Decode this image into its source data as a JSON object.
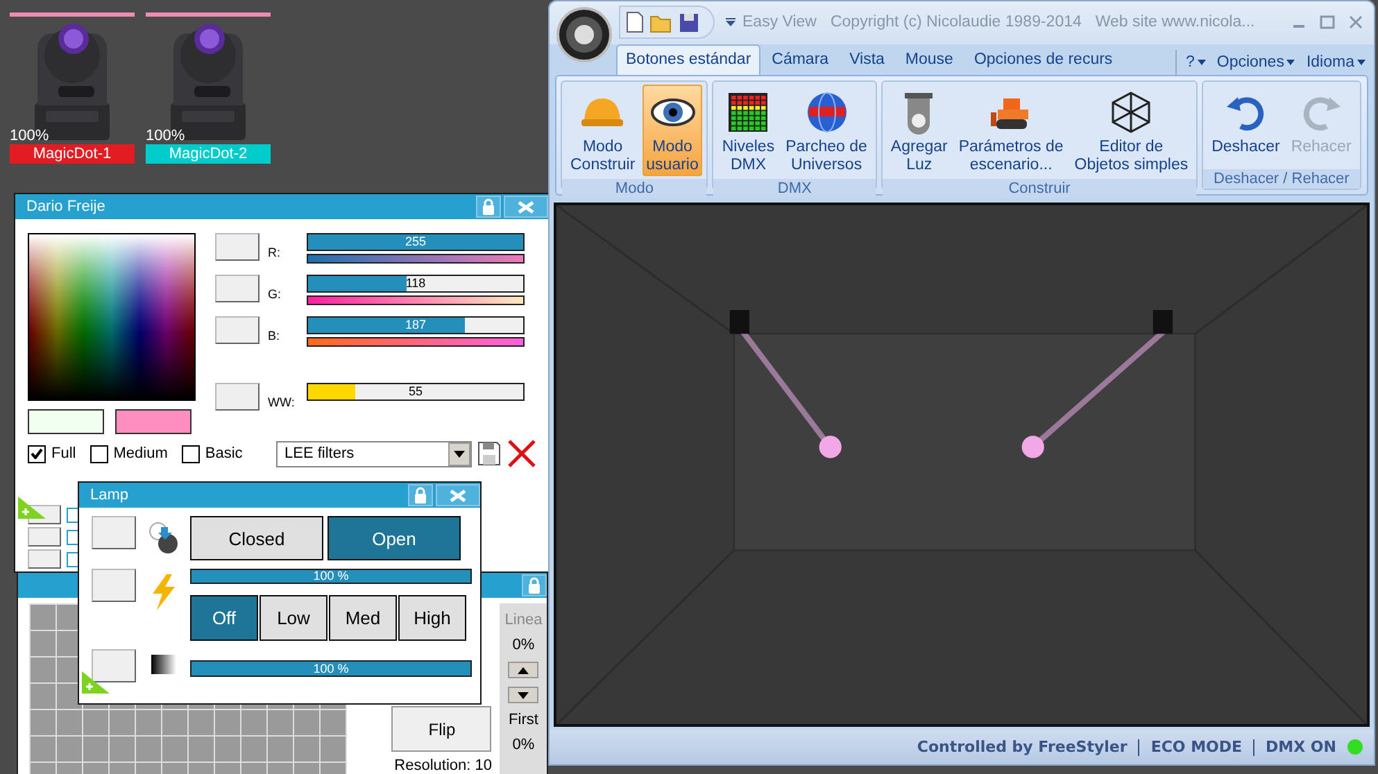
{
  "fixtures": [
    {
      "name": "MagicDot-1",
      "intensity": "100%",
      "color": "#e31b23"
    },
    {
      "name": "MagicDot-2",
      "intensity": "100%",
      "color": "#00cccc"
    }
  ],
  "color_window": {
    "title": "Dario Freije",
    "channels": [
      {
        "kind": "rgb",
        "name": "R:",
        "value": "255",
        "level": 1
      },
      {
        "kind": "rgb",
        "name": "G:",
        "value": "118",
        "level": 0.46
      },
      {
        "kind": "rgb",
        "name": "B:",
        "value": "187",
        "level": 0.73
      },
      {
        "kind": "white",
        "name": "WW:",
        "value": "55",
        "level": 0.22
      }
    ],
    "modes": [
      {
        "label": "Full",
        "checked": true
      },
      {
        "label": "Medium",
        "checked": false
      },
      {
        "label": "Basic",
        "checked": false
      }
    ],
    "filter_select": {
      "value": "LEE filters"
    }
  },
  "lamp_window": {
    "title": "Lamp",
    "shutter": [
      {
        "label": "Closed",
        "selected": false
      },
      {
        "label": "Open",
        "selected": true
      }
    ],
    "lamp_bar": {
      "reading": "100 %",
      "level": 1
    },
    "power": [
      {
        "label": "Off",
        "selected": true
      },
      {
        "label": "Low",
        "selected": false
      },
      {
        "label": "Med",
        "selected": false
      },
      {
        "label": "High",
        "selected": false
      }
    ],
    "dimmer_bar": {
      "reading": "100 %",
      "level": 1
    }
  },
  "back_window": {
    "button": "Flip",
    "resolution": "Resolution: 10",
    "side_title": "Linea",
    "top_reading": "0%",
    "first_label": "First",
    "bottom_reading": "0%"
  },
  "main_window": {
    "app_name": "Easy View",
    "copyright": "Copyright (c) Nicolaudie 1989-2014",
    "website": "Web site www.nicola...",
    "tabs": [
      {
        "label": "Botones estándar",
        "selected": true
      },
      {
        "label": "Cámara",
        "selected": false
      },
      {
        "label": "Vista",
        "selected": false
      },
      {
        "label": "Mouse",
        "selected": false
      },
      {
        "label": "Opciones de recurs",
        "selected": false
      }
    ],
    "menus": [
      "?",
      "Opciones",
      "Idioma"
    ],
    "groups": [
      {
        "label": "Modo",
        "buttons": [
          {
            "kind": "helmet",
            "lines": [
              "Modo",
              "Construir"
            ],
            "selected": false,
            "disabled": false
          },
          {
            "kind": "eye",
            "lines": [
              "Modo",
              "usuario"
            ],
            "selected": true,
            "disabled": false
          }
        ]
      },
      {
        "label": "DMX",
        "buttons": [
          {
            "kind": "levels",
            "lines": [
              "Niveles",
              "DMX"
            ],
            "selected": false,
            "disabled": false
          },
          {
            "kind": "globe",
            "lines": [
              "Parcheo de",
              "Universos"
            ],
            "selected": false,
            "disabled": false
          }
        ]
      },
      {
        "label": "Construir",
        "buttons": [
          {
            "kind": "spotlight",
            "lines": [
              "Agregar",
              "Luz"
            ],
            "selected": false,
            "disabled": false
          },
          {
            "kind": "bulldozer",
            "lines": [
              "Parámetros de",
              "escenario..."
            ],
            "selected": false,
            "disabled": false
          },
          {
            "kind": "cube",
            "lines": [
              "Editor de",
              "Objetos simples"
            ],
            "selected": false,
            "disabled": false
          }
        ]
      },
      {
        "label": "Deshacer / Rehacer",
        "buttons": [
          {
            "kind": "undo",
            "lines": [
              "Deshacer"
            ],
            "selected": false,
            "disabled": false
          },
          {
            "kind": "redo",
            "lines": [
              "Rehacer"
            ],
            "selected": false,
            "disabled": true
          }
        ]
      }
    ],
    "status": [
      "Controlled by FreeStyler",
      "ECO MODE",
      "DMX ON"
    ],
    "dmx_led": {
      "on": true
    }
  }
}
